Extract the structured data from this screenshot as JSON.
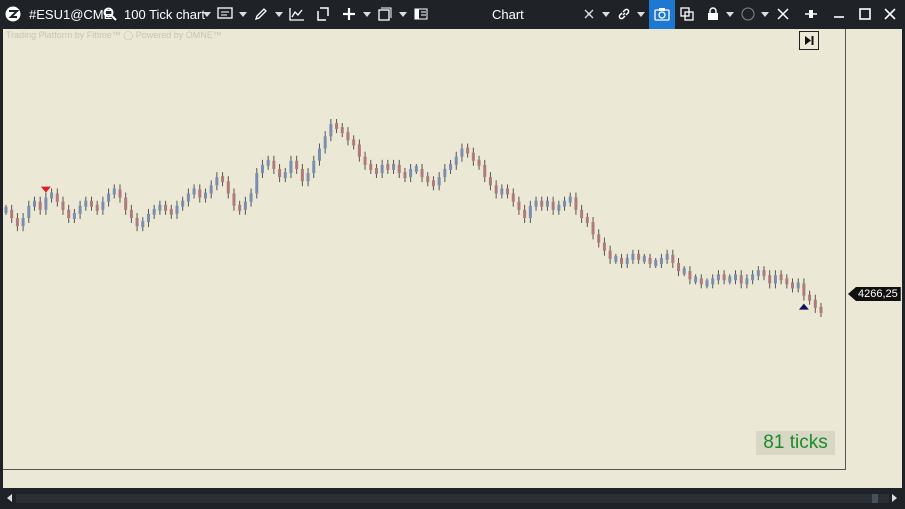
{
  "toolbar": {
    "symbol": "#ESU1@CME",
    "chart_type": "100 Tick chart",
    "window_title": "Chart",
    "icons": [
      "app-logo-icon",
      "search-icon",
      "template-icon",
      "draw-pencil-icon",
      "indicator-icon",
      "bar-style-icon",
      "crosshair-plus-icon",
      "window-layout-icon",
      "panel-icon",
      "cursor-icon",
      "link-icon",
      "camera-icon",
      "duplicate-icon",
      "lock-icon",
      "circle-color-icon",
      "tools-icon",
      "pin-icon",
      "minimize-icon",
      "maximize-icon",
      "close-icon"
    ]
  },
  "watermark": {
    "text": "Trading Platform by FitIme™ ◯ Powered by OMNE™"
  },
  "price_label": {
    "value": "4266,25"
  },
  "ticks_badge": {
    "text": "81 ticks"
  },
  "colors": {
    "background": "#ebe8d6",
    "up_bar": "#7a8fb0",
    "down_bar": "#b07a7a",
    "badge_text": "#1a8c2a",
    "toolbar": "#1f2328",
    "accent": "#1e78d2"
  },
  "chart_data": {
    "type": "ohlc-tick",
    "symbol": "#ESU1@CME",
    "interval": "100 ticks",
    "last_price": 4266.25,
    "markers": [
      {
        "type": "sell-arrow",
        "bar_index": 7
      },
      {
        "type": "buy-arrow",
        "bar_index": 140
      }
    ],
    "closes": [
      0.62,
      0.6,
      0.58,
      0.6,
      0.63,
      0.64,
      0.62,
      0.65,
      0.66,
      0.64,
      0.62,
      0.6,
      0.61,
      0.63,
      0.64,
      0.63,
      0.62,
      0.64,
      0.66,
      0.67,
      0.65,
      0.62,
      0.6,
      0.58,
      0.59,
      0.61,
      0.62,
      0.63,
      0.62,
      0.61,
      0.63,
      0.64,
      0.66,
      0.67,
      0.65,
      0.66,
      0.68,
      0.7,
      0.69,
      0.66,
      0.63,
      0.62,
      0.64,
      0.66,
      0.71,
      0.73,
      0.74,
      0.72,
      0.7,
      0.71,
      0.74,
      0.72,
      0.69,
      0.71,
      0.74,
      0.77,
      0.8,
      0.83,
      0.82,
      0.81,
      0.79,
      0.78,
      0.75,
      0.73,
      0.72,
      0.71,
      0.73,
      0.72,
      0.73,
      0.71,
      0.7,
      0.72,
      0.72,
      0.7,
      0.69,
      0.68,
      0.7,
      0.72,
      0.73,
      0.75,
      0.77,
      0.76,
      0.74,
      0.73,
      0.7,
      0.68,
      0.66,
      0.67,
      0.66,
      0.64,
      0.62,
      0.6,
      0.63,
      0.64,
      0.63,
      0.64,
      0.62,
      0.63,
      0.64,
      0.65,
      0.62,
      0.6,
      0.59,
      0.56,
      0.54,
      0.52,
      0.5,
      0.5,
      0.49,
      0.5,
      0.51,
      0.5,
      0.5,
      0.49,
      0.49,
      0.5,
      0.51,
      0.49,
      0.47,
      0.47,
      0.45,
      0.45,
      0.44,
      0.44,
      0.45,
      0.46,
      0.45,
      0.45,
      0.46,
      0.44,
      0.45,
      0.46,
      0.47,
      0.46,
      0.44,
      0.46,
      0.45,
      0.44,
      0.43,
      0.44,
      0.41,
      0.4,
      0.38,
      0.37
    ]
  }
}
